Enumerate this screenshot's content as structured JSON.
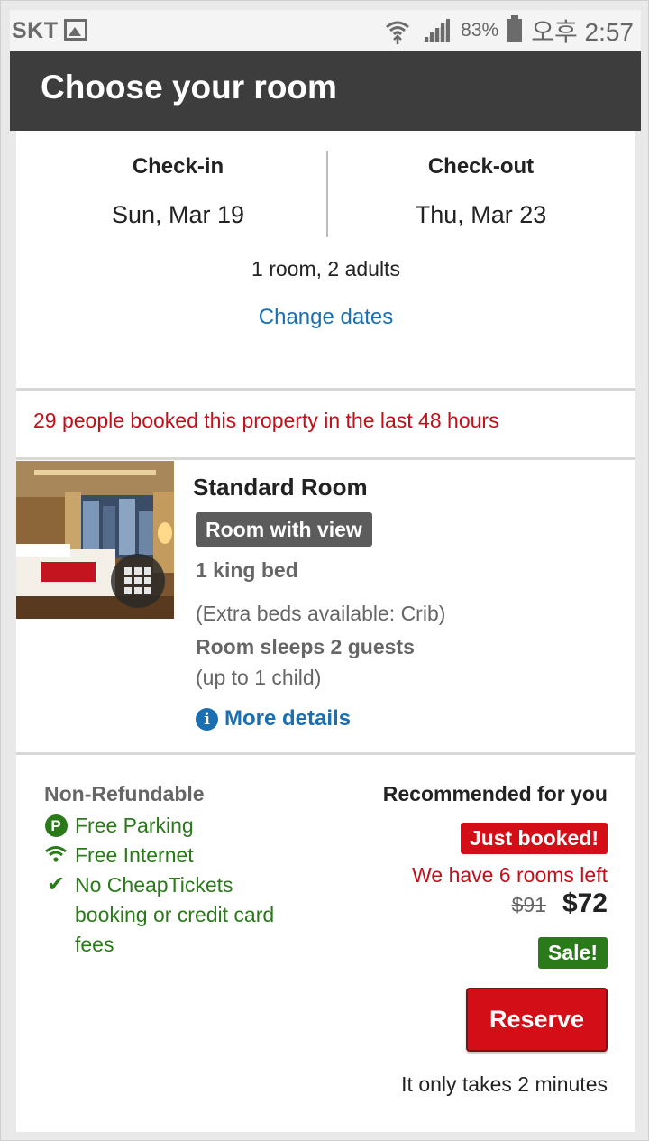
{
  "status_bar": {
    "carrier": "SKT",
    "battery": "83%",
    "time": "오후 2:57"
  },
  "header": {
    "title": "Choose your room"
  },
  "stay": {
    "checkin_label": "Check-in",
    "checkin_date": "Sun, Mar 19",
    "checkout_label": "Check-out",
    "checkout_date": "Thu, Mar 23",
    "guests": "1 room, 2 adults",
    "change_dates": "Change dates"
  },
  "social_proof": "29 people booked this property in the last 48 hours",
  "room": {
    "name": "Standard Room",
    "badge": "Room with view",
    "bed": "1 king bed",
    "extra_beds": "(Extra beds available: Crib)",
    "sleeps": "Room sleeps 2 guests",
    "child": "(up to 1 child)",
    "more_details": "More details"
  },
  "rate": {
    "policy": "Non-Refundable",
    "amenities": [
      {
        "icon": "parking-icon",
        "label": "Free Parking"
      },
      {
        "icon": "wifi-icon",
        "label": "Free Internet"
      },
      {
        "icon": "check-icon",
        "label": "No CheapTickets booking or credit card fees"
      }
    ],
    "recommended": "Recommended for you",
    "just_booked": "Just booked!",
    "rooms_left": "We have 6 rooms left",
    "old_price": "$91",
    "price": "$72",
    "sale": "Sale!",
    "reserve": "Reserve",
    "note": "It only takes 2 minutes"
  },
  "colors": {
    "header_bg": "#3d3d3d",
    "link": "#1a6fb3",
    "alert_red": "#c0101a",
    "button_red": "#d40e16",
    "green": "#2a7a1a"
  }
}
